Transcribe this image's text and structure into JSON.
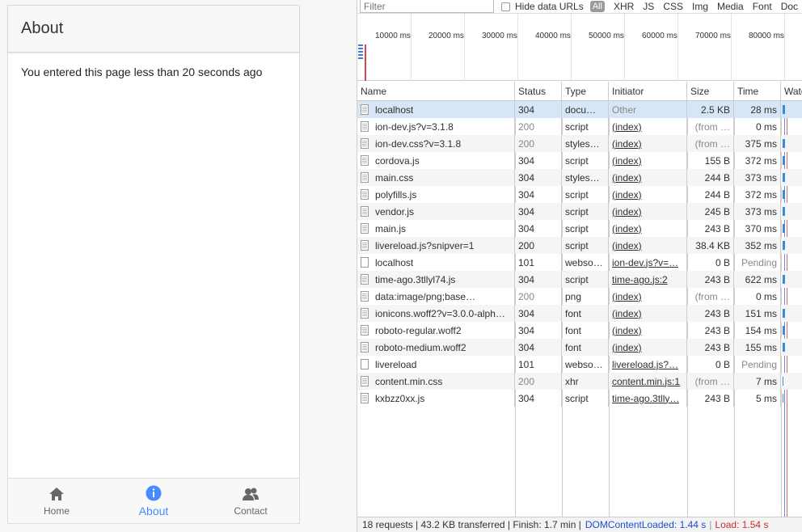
{
  "app": {
    "header_title": "About",
    "content_text": "You entered this page less than 20 seconds ago",
    "tabs": [
      {
        "label": "Home",
        "icon": "home-icon",
        "active": false
      },
      {
        "label": "About",
        "icon": "info-icon",
        "active": true
      },
      {
        "label": "Contact",
        "icon": "contacts-icon",
        "active": false
      }
    ],
    "accent_color": "#488aff"
  },
  "devtools": {
    "filter_placeholder": "Filter",
    "hide_data_urls_label": "Hide data URLs",
    "type_filters": [
      "All",
      "XHR",
      "JS",
      "CSS",
      "Img",
      "Media",
      "Font",
      "Doc"
    ],
    "overview_ticks": [
      "10000 ms",
      "20000 ms",
      "30000 ms",
      "40000 ms",
      "50000 ms",
      "60000 ms",
      "70000 ms",
      "80000 ms"
    ],
    "columns": [
      "Name",
      "Status",
      "Type",
      "Initiator",
      "Size",
      "Time",
      "Waterfall"
    ],
    "rows": [
      {
        "name": "localhost",
        "status": "304",
        "type": "docu…",
        "initiator": "Other",
        "size": "2.5 KB",
        "time": "28 ms",
        "selected": true
      },
      {
        "name": "ion-dev.js?v=3.1.8",
        "status": "200",
        "type": "script",
        "initiator": "(index)",
        "size": "(from …",
        "time": "0 ms"
      },
      {
        "name": "ion-dev.css?v=3.1.8",
        "status": "200",
        "type": "styles…",
        "initiator": "(index)",
        "size": "(from …",
        "time": "375 ms"
      },
      {
        "name": "cordova.js",
        "status": "304",
        "type": "script",
        "initiator": "(index)",
        "size": "155 B",
        "time": "372 ms"
      },
      {
        "name": "main.css",
        "status": "304",
        "type": "styles…",
        "initiator": "(index)",
        "size": "244 B",
        "time": "373 ms"
      },
      {
        "name": "polyfills.js",
        "status": "304",
        "type": "script",
        "initiator": "(index)",
        "size": "244 B",
        "time": "372 ms"
      },
      {
        "name": "vendor.js",
        "status": "304",
        "type": "script",
        "initiator": "(index)",
        "size": "245 B",
        "time": "373 ms"
      },
      {
        "name": "main.js",
        "status": "304",
        "type": "script",
        "initiator": "(index)",
        "size": "243 B",
        "time": "370 ms"
      },
      {
        "name": "livereload.js?snipver=1",
        "status": "200",
        "type": "script",
        "initiator": "(index)",
        "size": "38.4 KB",
        "time": "352 ms"
      },
      {
        "name": "localhost",
        "status": "101",
        "type": "webso…",
        "initiator": "ion-dev.js?v=…",
        "size": "0 B",
        "time": "Pending"
      },
      {
        "name": "time-ago.3tllyl74.js",
        "status": "304",
        "type": "script",
        "initiator": "time-ago.js:2",
        "size": "243 B",
        "time": "622 ms"
      },
      {
        "name": "data:image/png;base…",
        "status": "200",
        "type": "png",
        "initiator": "(index)",
        "size": "(from …",
        "time": "0 ms"
      },
      {
        "name": "ionicons.woff2?v=3.0.0-alph…",
        "status": "304",
        "type": "font",
        "initiator": "(index)",
        "size": "243 B",
        "time": "151 ms"
      },
      {
        "name": "roboto-regular.woff2",
        "status": "304",
        "type": "font",
        "initiator": "(index)",
        "size": "243 B",
        "time": "154 ms"
      },
      {
        "name": "roboto-medium.woff2",
        "status": "304",
        "type": "font",
        "initiator": "(index)",
        "size": "243 B",
        "time": "155 ms"
      },
      {
        "name": "livereload",
        "status": "101",
        "type": "webso…",
        "initiator": "livereload.js?…",
        "size": "0 B",
        "time": "Pending"
      },
      {
        "name": "content.min.css",
        "status": "200",
        "type": "xhr",
        "initiator": "content.min.js:1",
        "size": "(from …",
        "time": "7 ms"
      },
      {
        "name": "kxbzz0xx.js",
        "status": "304",
        "type": "script",
        "initiator": "time-ago.3tlly…",
        "size": "243 B",
        "time": "5 ms"
      }
    ],
    "status_bar": {
      "summary": "18 requests | 43.2 KB transferred | Finish: 1.7 min |",
      "dom_content_loaded": "DOMContentLoaded: 1.44 s",
      "sep": "|",
      "load": "Load: 1.54 s"
    }
  }
}
